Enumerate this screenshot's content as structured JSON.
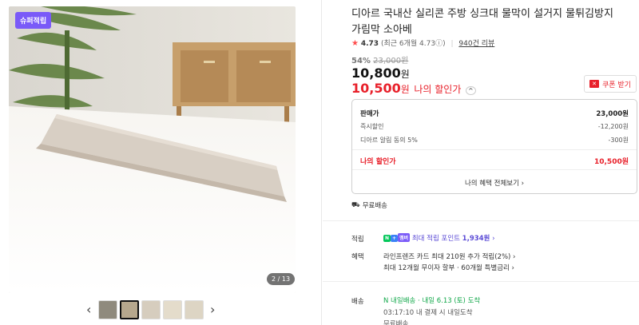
{
  "gallery": {
    "badge": "슈퍼적립",
    "counter": "2 / 13",
    "prev_arrow": "‹",
    "next_arrow": "›",
    "thumb_count": 5,
    "active_thumb": 2
  },
  "product": {
    "title": "디아르 국내산 실리콘 주방 싱크대 물막이 설거지 물튀김방지 가림막 소아베",
    "rating": "4.73",
    "rating_recent": "(최근 6개월 4.73",
    "rating_info_icon": "ⓘ",
    "rating_close": ")",
    "review_count": "940건 리뷰",
    "discount_pct": "54%",
    "original_price": "23,000원",
    "price": "10,800",
    "price_unit": "원",
    "my_price": "10,500",
    "my_price_unit": "원",
    "my_price_label": "나의 할인가",
    "my_price_chevron": "^",
    "coupon_label": "쿠폰 받기"
  },
  "breakdown": {
    "rows": [
      {
        "label": "판매가",
        "value": "23,000원"
      },
      {
        "label": "즉시할인",
        "value": "-12,200원"
      },
      {
        "label": "디아르 알림 동의 5%",
        "value": "-300원"
      }
    ],
    "final_label": "나의 할인가",
    "final_value": "10,500원",
    "all_benefits": "나의 혜택 전체보기 ›"
  },
  "shipping_free": "무료배송",
  "details": {
    "points_label": "적립",
    "points_pill_n": "N",
    "points_pill_plus": "+",
    "points_pill_club": "멤버",
    "points_text": "최대 적립 포인트",
    "points_value": "1,934원",
    "points_chev": "›",
    "benefit_label": "혜택",
    "benefit_line1": "라인프렌즈 카드 최대 210원 추가 적립(2%) ›",
    "benefit_line2": "최대 12개월 무이자 할부 · 60개월 특별금리 ›",
    "delivery_label": "배송",
    "delivery_pill": "N 내일배송",
    "delivery_date": "· 내일 6.13 (토) 도착",
    "delivery_time": "03:17:10  내 결제 시 내일도착",
    "delivery_free": "무료배송"
  },
  "colors": {
    "accent_red": "#e8202a",
    "badge_purple": "#7a5af8",
    "delivery_green": "#12a84a"
  }
}
